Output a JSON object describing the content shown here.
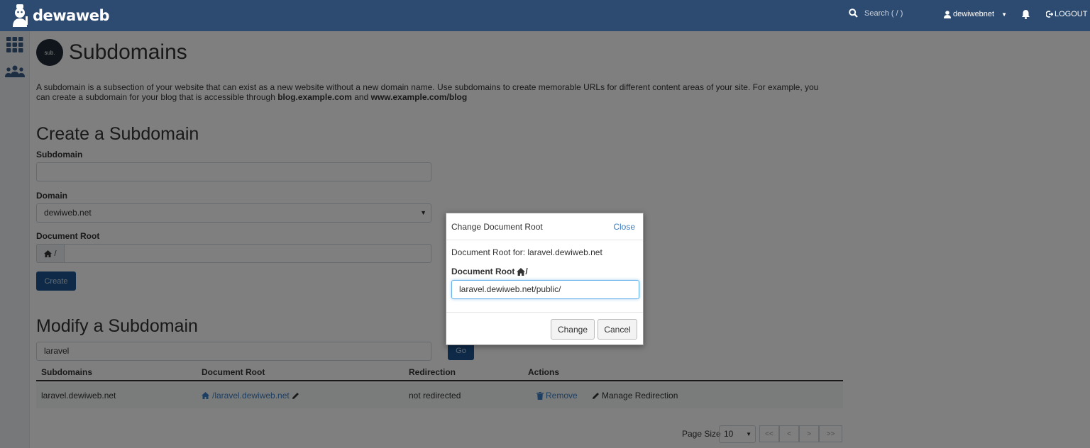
{
  "header": {
    "logo_text": "dewaweb",
    "search_placeholder": "Search ( / )",
    "username": "dewiwebnet",
    "logout_label": "LOGOUT"
  },
  "page": {
    "badge_text": "sub.",
    "title": "Subdomains",
    "description_part1": "A subdomain is a subsection of your website that can exist as a new website without a new domain name. Use subdomains to create memorable URLs for different content areas of your site. For example, you can create a subdomain for your blog that is accessible through ",
    "description_bold1": "blog.example.com",
    "description_and": " and ",
    "description_bold2": "www.example.com/blog"
  },
  "create": {
    "heading": "Create a Subdomain",
    "subdomain_label": "Subdomain",
    "subdomain_value": "",
    "domain_label": "Domain",
    "domain_value": "dewiweb.net",
    "docroot_label": "Document Root",
    "docroot_prefix": "/",
    "create_button": "Create"
  },
  "modify": {
    "heading": "Modify a Subdomain",
    "search_value": "laravel",
    "go_button": "Go",
    "columns": [
      "Subdomains",
      "Document Root",
      "Redirection",
      "Actions"
    ],
    "rows": [
      {
        "subdomain": "laravel.dewiweb.net",
        "docroot": "/laravel.dewiweb.net",
        "redirection": "not redirected",
        "remove": "Remove",
        "manage": "Manage Redirection"
      }
    ],
    "page_size_label": "Page Size",
    "page_size_value": "10",
    "pager": [
      "<<",
      "<",
      ">",
      ">>"
    ]
  },
  "modal": {
    "title": "Change Document Root",
    "close_label": "Close",
    "for_text": "Document Root for: laravel.dewiweb.net",
    "field_label": "Document Root",
    "field_suffix": "/",
    "field_value": "laravel.dewiweb.net/public/",
    "change_button": "Change",
    "cancel_button": "Cancel"
  }
}
